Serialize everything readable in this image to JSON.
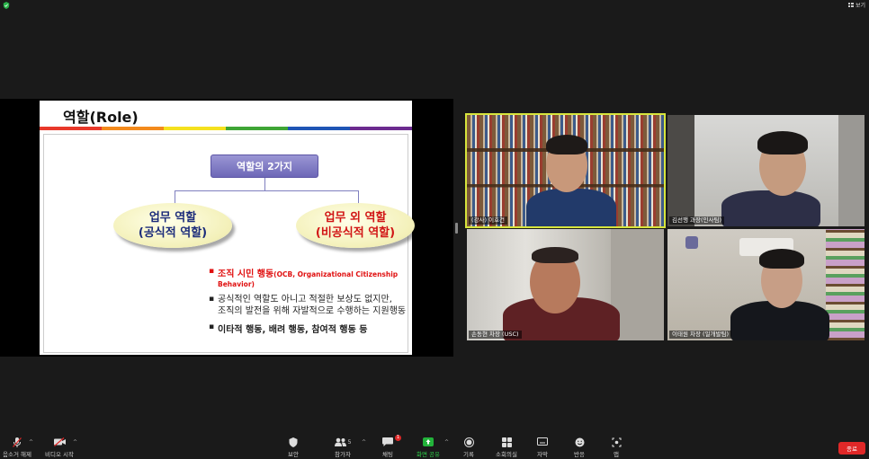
{
  "top_bar": {
    "view_label": "보기"
  },
  "slide": {
    "title": "역할(Role)",
    "rainbow_colors": [
      "#e8382a",
      "#f38a1c",
      "#f5e11e",
      "#3fa535",
      "#1f55b5",
      "#6c2b8f"
    ],
    "top_box": "역할의 2가지",
    "left_oval": [
      "업무 역할",
      "(공식적 역할)"
    ],
    "right_oval": [
      "업무 외 역할",
      "(비공식적 역할)"
    ],
    "bullet1_main": "조직 시민 행동",
    "bullet1_sub": "(OCB, Organizational Citizenship Behavior)",
    "bullet2_line1": "공식적인 역할도 아니고 적절한 보상도 없지만,",
    "bullet2_line2": "조직의 발전을 위해 자발적으로 수행하는 지원행동",
    "bullet3": "이타적 행동, 배려 행동, 참여적 행동 등"
  },
  "participants": [
    {
      "name": "(강사) 이호건"
    },
    {
      "name": "김선행 과장(인사팀)"
    },
    {
      "name": "손동현 차장 (USC)"
    },
    {
      "name": "이태원 차장 (일개발팀)"
    }
  ],
  "toolbar": {
    "mute": "음소거 해제",
    "video": "비디오 시작",
    "security": "보안",
    "participants": "참가자",
    "participants_count": "5",
    "chat": "채팅",
    "chat_badge": "1",
    "share": "화면 공유",
    "record": "기록",
    "breakout": "소회의실",
    "captions": "자막",
    "reactions": "반응",
    "apps": "앱",
    "end": "종료"
  }
}
